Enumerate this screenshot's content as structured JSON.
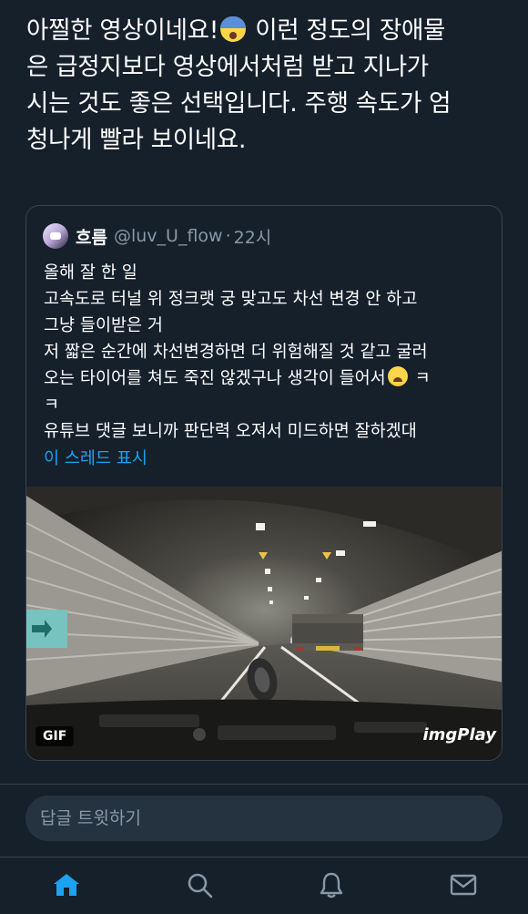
{
  "tweet": {
    "text_lines": [
      "아찔한 영상이네요!",
      "이런 정도의 장애물",
      "은 급정지보다 영상에서처럼 받고 지나가",
      "시는 것도 좋은 선택입니다. 주행 속도가 엄",
      "청나게 빨라 보이네요."
    ],
    "emoji": "scream-icon"
  },
  "quote": {
    "name": "흐름",
    "handle": "@luv_U_flow",
    "separator": "·",
    "time": "22시",
    "lines": [
      "올해 잘 한 일",
      "고속도로 터널 위 정크랫 궁 맞고도 차선 변경 안 하고",
      "그냥 들이받은 거",
      "저 짧은 순간에 차선변경하면 더 위험해질 것 같고 굴러",
      "오는 타이어를 쳐도 죽진 않겠구나 생각이 들어서",
      "ㅋ",
      "ㅋ",
      "유튜브 댓글 보니까 판단력 오져서 미드하면 잘하겠대"
    ],
    "show_thread": "이 스레드 표시",
    "media": {
      "gif_badge": "GIF",
      "watermark": "imgPlay"
    }
  },
  "reply": {
    "placeholder": "답글 트윗하기"
  },
  "nav": {
    "items": [
      "home-icon",
      "search-icon",
      "notifications-icon",
      "messages-icon"
    ],
    "active_color": "#1da1f2",
    "inactive_color": "#8899a6"
  }
}
